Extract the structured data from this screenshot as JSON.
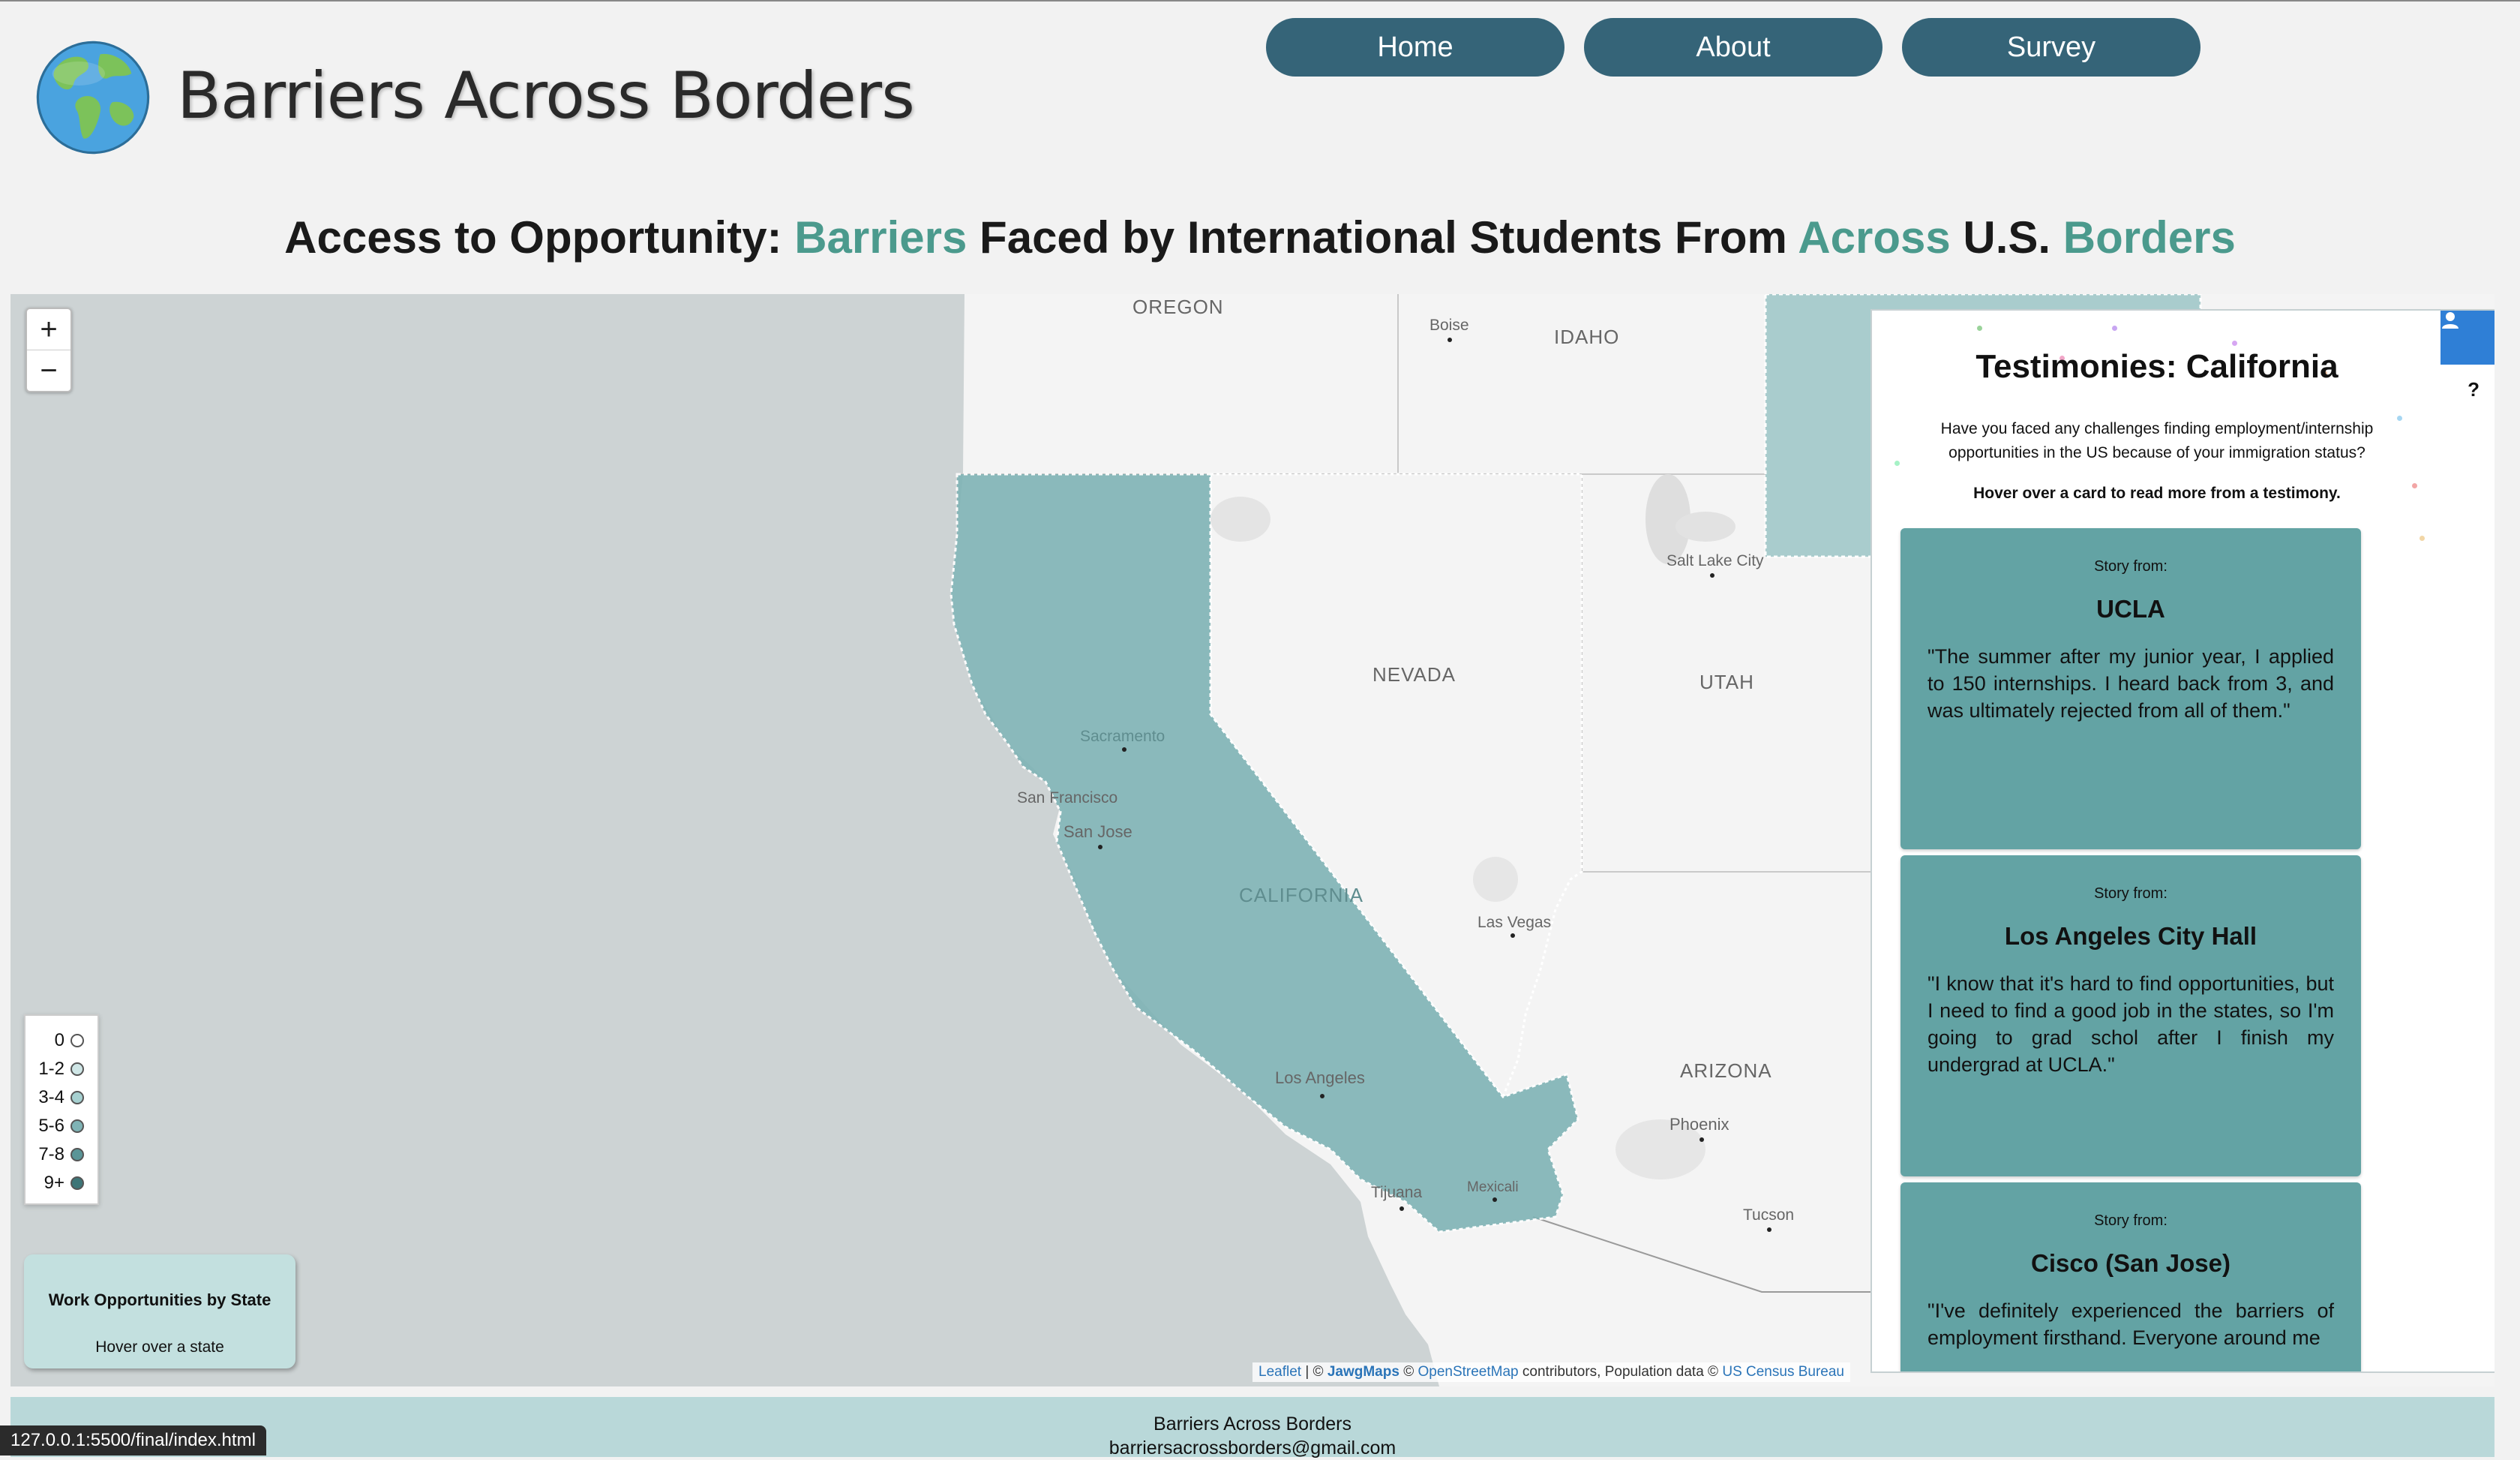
{
  "header": {
    "site_title": "Barriers Across Borders",
    "nav": [
      {
        "label": "Home"
      },
      {
        "label": "About"
      },
      {
        "label": "Survey"
      }
    ]
  },
  "headline": {
    "part1": "Access to Opportunity: ",
    "h1": "Barriers",
    "part2": " Faced by International Students From ",
    "h2": "Across",
    "part3": " U.S. ",
    "h3": "Borders"
  },
  "colors": {
    "nav_bg": "#356478",
    "highlight": "#4b9a8d",
    "state_fill": "#7fb3b5",
    "card_bg": "#63a3a4",
    "info_bg": "#c3e0df",
    "footer_bg": "#b9d8d9"
  },
  "map": {
    "zoom_in": "+",
    "zoom_out": "−",
    "state_labels": {
      "oregon": "OREGON",
      "idaho": "IDAHO",
      "nevada": "NEVADA",
      "utah": "UTAH",
      "california": "CALIFORNIA",
      "arizona": "ARIZONA"
    },
    "city_labels": {
      "boise": "Boise",
      "salt_lake_city": "Salt Lake City",
      "sacramento": "Sacramento",
      "san_francisco": "San Francisco",
      "san_jose": "San Jose",
      "las_vegas": "Las Vegas",
      "los_angeles": "Los Angeles",
      "phoenix": "Phoenix",
      "tijuana": "Tijuana",
      "mexicali": "Mexicali",
      "tucson": "Tucson"
    },
    "legend": [
      "0",
      "1-2",
      "3-4",
      "5-6",
      "7-8",
      "9+"
    ],
    "info_box": {
      "title": "Work Opportunities by State",
      "subtitle": "Hover over a state"
    },
    "attribution": {
      "leaflet": "Leaflet",
      "sep1": " | © ",
      "jawg": "JawgMaps",
      "sep2": " © ",
      "osm": "OpenStreetMap",
      "sep3": " contributors, Population data © ",
      "census": "US Census Bureau"
    },
    "selected_state": "California"
  },
  "panel": {
    "title": "Testimonies: California",
    "question": "Have you faced any challenges finding employment/internship opportunities in the US because of your immigration status?",
    "hint": "Hover over a card to read more from a testimony.",
    "help": "?",
    "user_icon": "user-icon",
    "cards": [
      {
        "from_label": "Story from:",
        "place": "UCLA",
        "quote": "\"The summer after my junior year, I applied to 150 internships. I heard back from 3, and was ultimately rejected from all of them.\""
      },
      {
        "from_label": "Story from:",
        "place": "Los Angeles City Hall",
        "quote": "\"I know that it's hard to find opportunities, but I need to find a good job in the states, so I'm going to grad schol after I finish my undergrad at UCLA.\""
      },
      {
        "from_label": "Story from:",
        "place": "Cisco (San Jose)",
        "quote": "\"I've definitely experienced the barriers of employment firsthand. Everyone around me"
      }
    ]
  },
  "footer": {
    "name": "Barriers Across Borders",
    "email": "barriersacrossborders@gmail.com"
  },
  "status_bar": {
    "url": "127.0.0.1:5500/final/index.html"
  }
}
